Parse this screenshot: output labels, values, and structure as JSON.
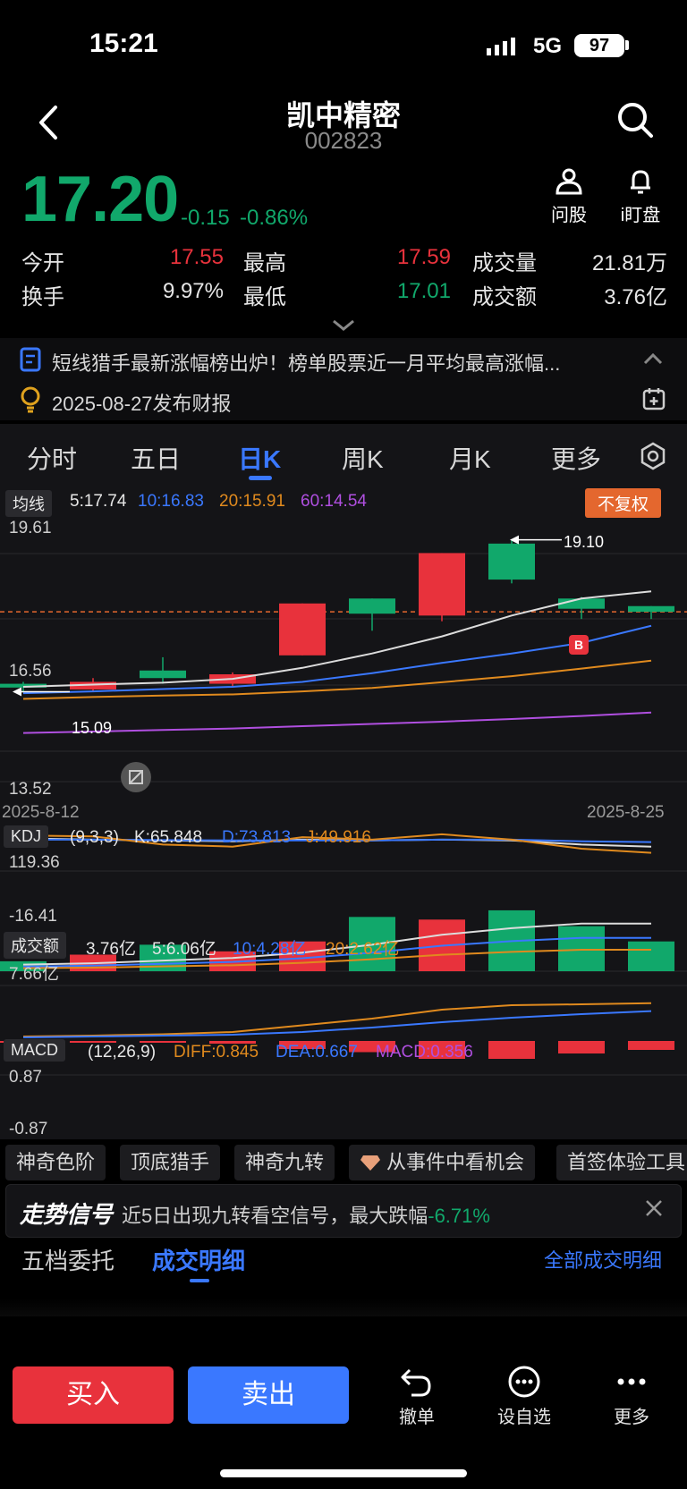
{
  "status": {
    "time": "15:21",
    "network": "5G",
    "battery": "97"
  },
  "header": {
    "name": "凯中精密",
    "code": "002823"
  },
  "quote": {
    "price": "17.20",
    "change": "-0.15",
    "change_pct": "-0.86%",
    "tools": [
      {
        "label": "问股",
        "icon": "person-icon"
      },
      {
        "label": "i盯盘",
        "icon": "bell-icon"
      }
    ],
    "stats": [
      {
        "label": "今开",
        "value": "17.55",
        "color": "#e8323c"
      },
      {
        "label": "最高",
        "value": "17.59",
        "color": "#e8323c"
      },
      {
        "label": "成交量",
        "value": "21.81万",
        "color": "#e6e6e6"
      },
      {
        "label": "换手",
        "value": "9.97%",
        "color": "#e6e6e6"
      },
      {
        "label": "最低",
        "value": "17.01",
        "color": "#11a86b"
      },
      {
        "label": "成交额",
        "value": "3.76亿",
        "color": "#e6e6e6"
      }
    ]
  },
  "news": [
    {
      "text": "短线猎手最新涨幅榜出炉！榜单股票近一月平均最高涨幅...",
      "icon": "document-icon"
    },
    {
      "text": "2025-08-27发布财报",
      "icon": "lightbulb-icon"
    }
  ],
  "tabs": [
    {
      "label": "分时",
      "active": false
    },
    {
      "label": "五日",
      "active": false
    },
    {
      "label": "日K",
      "active": true
    },
    {
      "label": "周K",
      "active": false
    },
    {
      "label": "月K",
      "active": false
    },
    {
      "label": "更多",
      "active": false
    }
  ],
  "ma_bar": {
    "label": "均线",
    "ma5": "5:17.74",
    "ma10": "10:16.83",
    "ma20": "20:15.91",
    "ma60": "60:14.54",
    "adjust": "不复权"
  },
  "kline": {
    "y_high": "19.61",
    "y_mid": "16.56",
    "y_low": "13.52",
    "date_start": "2025-8-12",
    "date_end": "2025-8-25",
    "max_label": "19.10",
    "min_label": "15.09",
    "buy_marker": "B"
  },
  "kdj_bar": {
    "label": "KDJ",
    "params": "(9,3,3)",
    "k": "K:65.848",
    "d": "D:73.813",
    "j": "J:49.916",
    "y_high": "119.36",
    "y_low": "-16.41"
  },
  "vol_bar": {
    "label": "成交额",
    "total": "3.76亿",
    "ma5": "5:6.06亿",
    "ma10": "10:4.28亿",
    "ma20": "20:2.62亿",
    "y_high": "7.66亿"
  },
  "macd_bar": {
    "label": "MACD",
    "params": "(12,26,9)",
    "diff": "DIFF:0.845",
    "dea": "DEA:0.667",
    "macd": "MACD:0.356",
    "y_high": "0.87",
    "y_low": "-0.87"
  },
  "chips": [
    "神奇色阶",
    "顶底猎手",
    "神奇九转",
    "从事件中看机会",
    "首签体验工具"
  ],
  "signal": {
    "title": "走势信号",
    "text": "近5日出现九转看空信号，最大跌幅",
    "value": "-6.71%"
  },
  "trade_tabs": {
    "tab1": "五档委托",
    "tab2": "成交明细",
    "link": "全部成交明细"
  },
  "bottom": {
    "buy": "买入",
    "sell": "卖出",
    "tools": [
      {
        "label": "撤单"
      },
      {
        "label": "设自选"
      },
      {
        "label": "更多"
      }
    ]
  },
  "chart_data": {
    "type": "candlestick",
    "x": [
      "2025-8-12",
      "",
      "",
      "",
      "",
      "",
      "",
      "",
      "",
      "2025-8-25"
    ],
    "candles": [
      {
        "open": 15.3,
        "close": 15.2,
        "high": 15.35,
        "low": 15.1
      },
      {
        "open": 15.15,
        "close": 15.35,
        "high": 15.45,
        "low": 15.1
      },
      {
        "open": 15.65,
        "close": 15.45,
        "high": 16.0,
        "low": 15.3
      },
      {
        "open": 15.3,
        "close": 15.55,
        "high": 15.6,
        "low": 15.2
      },
      {
        "open": 16.05,
        "close": 17.42,
        "high": 17.42,
        "low": 16.05
      },
      {
        "open": 17.55,
        "close": 17.15,
        "high": 17.55,
        "low": 16.7
      },
      {
        "open": 17.1,
        "close": 18.75,
        "high": 18.75,
        "low": 16.95
      },
      {
        "open": 19.0,
        "close": 18.05,
        "high": 19.1,
        "low": 17.95
      },
      {
        "open": 17.55,
        "close": 17.28,
        "high": 17.59,
        "low": 17.01
      },
      {
        "open": 17.35,
        "close": 17.2,
        "high": 17.35,
        "low": 17.01
      }
    ],
    "ma5": [
      15.22,
      15.28,
      15.33,
      15.43,
      15.72,
      16.1,
      16.55,
      17.1,
      17.55,
      17.74
    ],
    "ma10": [
      15.05,
      15.1,
      15.16,
      15.22,
      15.35,
      15.58,
      15.85,
      16.1,
      16.38,
      16.83
    ],
    "ma20": [
      14.9,
      14.95,
      14.99,
      15.02,
      15.1,
      15.19,
      15.34,
      15.5,
      15.7,
      15.91
    ],
    "ma60": [
      14.0,
      14.04,
      14.08,
      14.12,
      14.18,
      14.24,
      14.3,
      14.37,
      14.45,
      14.54
    ],
    "ylim": [
      13.52,
      19.61
    ],
    "dashed_price": 17.2,
    "volume": [
      0.15,
      0.25,
      0.4,
      0.3,
      0.45,
      0.82,
      0.78,
      0.92,
      0.68,
      0.45
    ],
    "volume_up": [
      false,
      true,
      false,
      true,
      true,
      false,
      true,
      false,
      false,
      false
    ],
    "vol_ma": [
      0.1,
      0.12,
      0.16,
      0.2,
      0.28,
      0.4,
      0.55,
      0.65,
      0.72,
      0.72
    ],
    "kdj_k": [
      0.75,
      0.72,
      0.7,
      0.68,
      0.72,
      0.7,
      0.72,
      0.7,
      0.6,
      0.55
    ],
    "kdj_d": [
      0.72,
      0.72,
      0.71,
      0.7,
      0.7,
      0.7,
      0.72,
      0.72,
      0.68,
      0.66
    ],
    "kdj_j": [
      0.82,
      0.8,
      0.6,
      0.55,
      0.78,
      0.72,
      0.85,
      0.72,
      0.5,
      0.4
    ],
    "macd": [
      -0.02,
      -0.03,
      -0.03,
      -0.06,
      -0.18,
      -0.25,
      -0.4,
      -0.4,
      -0.28,
      -0.2
    ],
    "diff": [
      0.1,
      0.12,
      0.15,
      0.2,
      0.35,
      0.5,
      0.7,
      0.8,
      0.82,
      0.845
    ],
    "dea": [
      0.08,
      0.1,
      0.12,
      0.14,
      0.2,
      0.3,
      0.42,
      0.52,
      0.6,
      0.667
    ]
  }
}
